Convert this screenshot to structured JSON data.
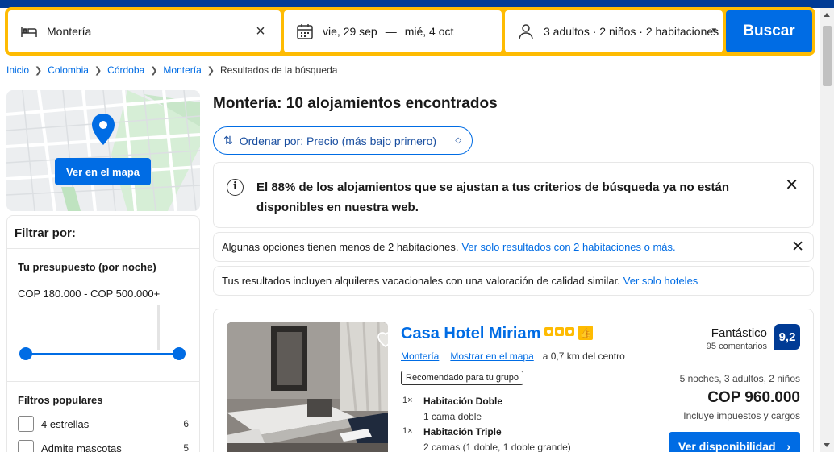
{
  "search": {
    "destination": "Montería",
    "checkin": "vie, 29 sep",
    "date_separator": "—",
    "checkout": "mié, 4 oct",
    "guests": "3 adultos · 2 niños · 2 habitaciones",
    "button_label": "Buscar"
  },
  "breadcrumb": {
    "items": [
      "Inicio",
      "Colombia",
      "Córdoba",
      "Montería"
    ],
    "current": "Resultados de la búsqueda"
  },
  "map": {
    "button_label": "Ver en el mapa"
  },
  "filters": {
    "title": "Filtrar por:",
    "budget_title": "Tu presupuesto (por noche)",
    "budget_range": "COP 180.000 - COP 500.000+",
    "budget_min_fraction": 0,
    "budget_max_fraction": 1,
    "popular_title": "Filtros populares",
    "options": [
      {
        "label": "4 estrellas",
        "count": "6"
      },
      {
        "label": "Admite mascotas",
        "count": "5"
      }
    ]
  },
  "results": {
    "title": "Montería: 10 alojamientos encontrados",
    "sort_label": "Ordenar por: Precio (más bajo primero)",
    "alert_text": "El 88% de los alojamientos que se ajustan a tus criterios de búsqueda ya no están disponibles en nuestra web.",
    "note1_text": "Algunas opciones tienen menos de 2 habitaciones.",
    "note1_link": "Ver solo resultados con 2 habitaciones o más.",
    "note2_text": "Tus resultados incluyen alquileres vacacionales con una valoración de calidad similar.",
    "note2_link": "Ver solo hoteles"
  },
  "hotel": {
    "name": "Casa Hotel Miriam",
    "stars": 3,
    "city_link": "Montería",
    "map_link": "Mostrar en el mapa",
    "distance": "a 0,7 km del centro",
    "tag": "Recomendado para tu grupo",
    "rooms": [
      {
        "qty": "1×",
        "name": "Habitación Doble",
        "beds": "1 cama doble"
      },
      {
        "qty": "1×",
        "name": "Habitación Triple",
        "beds": "2 camas (1 doble, 1 doble grande)"
      }
    ],
    "rating_word": "Fantástico",
    "rating_count": "95 comentarios",
    "score": "9,2",
    "stay": "5 noches, 3 adultos, 2 niños",
    "price": "COP 960.000",
    "taxes": "Incluye impuestos y cargos",
    "button_label": "Ver disponibilidad",
    "button_arrow": "›"
  },
  "colors": {
    "brand_blue": "#003b95",
    "action_blue": "#006ce4",
    "search_yellow": "#febb02"
  },
  "icons": [
    "bed-icon",
    "clear-icon",
    "calendar-icon",
    "person-icon",
    "chevron-down-icon",
    "map-pin-icon",
    "sort-icon",
    "info-icon",
    "close-icon",
    "heart-icon",
    "thumbs-up-icon"
  ]
}
